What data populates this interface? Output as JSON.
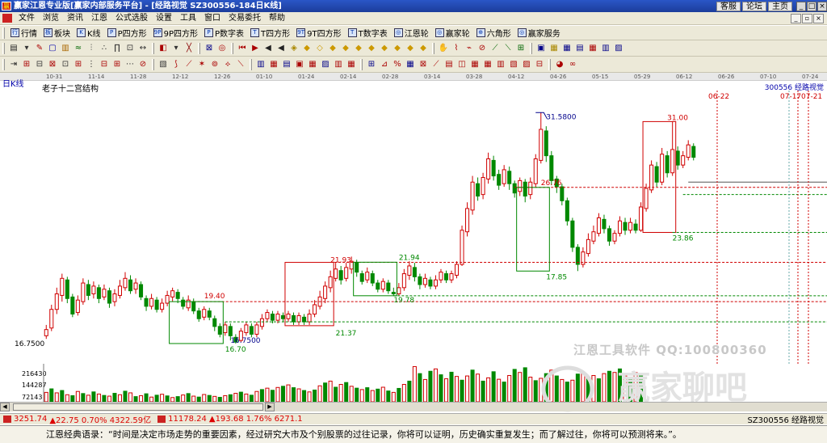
{
  "titlebar": {
    "title": "赢家江恩专业版[赢家内部服务平台] - [经路视觉  SZ300556-184日K线]",
    "links": [
      "客服",
      "论坛",
      "主页"
    ]
  },
  "menu": [
    "文件",
    "浏览",
    "资讯",
    "江恩",
    "公式选股",
    "设置",
    "工具",
    "窗口",
    "交易委托",
    "帮助"
  ],
  "toolbar1": [
    {
      "icon": "行",
      "label": "行情"
    },
    {
      "icon": "板",
      "label": "板块"
    },
    {
      "icon": "K",
      "label": "K线"
    },
    {
      "icon": "P",
      "label": "P四方形"
    },
    {
      "icon": "9P",
      "label": "9P四方形"
    },
    {
      "icon": "P",
      "label": "P数字表"
    },
    {
      "icon": "T",
      "label": "T四方形"
    },
    {
      "icon": "9T",
      "label": "9T四方形"
    },
    {
      "icon": "T",
      "label": "T数字表"
    },
    {
      "icon": "◎",
      "label": "江恩轮"
    },
    {
      "icon": "◎",
      "label": "赢家轮"
    },
    {
      "icon": "⊕",
      "label": "六角形"
    },
    {
      "icon": "◎",
      "label": "赢家服务"
    }
  ],
  "chart": {
    "period_label": "日K线",
    "title": "老子十二宫结构",
    "stock_label": "300556  经路视觉",
    "watermark": "江恩工具软件  QQ:100800360",
    "date_ticks": [
      "10-31",
      "11-14",
      "11-28",
      "12-12",
      "12-26",
      "01-10",
      "01-24",
      "02-14",
      "02-28",
      "03-14",
      "03-28",
      "04-12",
      "04-26",
      "05-15",
      "05-29",
      "06-12",
      "06-26",
      "07-10",
      "07-24"
    ],
    "left_price_label": "16.7500",
    "volume_ticks": [
      "216430",
      "144287",
      "72143"
    ],
    "top_date_labels": [
      "06-22",
      "07-17",
      "07-21"
    ]
  },
  "chart_data": {
    "type": "candlestick",
    "title": "老子十二宫结构",
    "price_annotations": [
      "31.5800",
      "31.00",
      "26.76",
      "23.86",
      "21.94",
      "21.93",
      "21.37",
      "19.40",
      "19.78",
      "17.85",
      "16.70",
      "16.7500"
    ],
    "candles": [
      [
        17.2,
        17.6,
        17.9,
        17.0
      ],
      [
        17.7,
        18.9,
        19.2,
        17.5
      ],
      [
        18.9,
        19.9,
        20.3,
        18.6
      ],
      [
        19.8,
        20.9,
        21.2,
        19.4
      ],
      [
        20.8,
        19.6,
        21.0,
        19.3
      ],
      [
        19.7,
        18.6,
        19.9,
        18.4
      ],
      [
        18.7,
        19.5,
        19.8,
        18.5
      ],
      [
        19.4,
        20.6,
        20.9,
        19.2
      ],
      [
        20.5,
        19.8,
        20.8,
        19.5
      ],
      [
        19.9,
        20.4,
        20.7,
        19.6
      ],
      [
        20.3,
        19.6,
        20.5,
        19.3
      ],
      [
        19.7,
        20.2,
        20.5,
        19.5
      ],
      [
        20.1,
        19.3,
        20.3,
        19.0
      ],
      [
        19.4,
        19.9,
        20.2,
        19.1
      ],
      [
        19.8,
        20.4,
        20.8,
        19.6
      ],
      [
        20.3,
        20.9,
        21.3,
        20.1
      ],
      [
        20.8,
        20.1,
        21.1,
        19.9
      ],
      [
        20.2,
        20.6,
        20.9,
        19.9
      ],
      [
        20.5,
        19.7,
        20.7,
        19.5
      ],
      [
        19.6,
        19.1,
        19.8,
        18.8
      ],
      [
        19.1,
        19.6,
        19.9,
        18.9
      ],
      [
        19.5,
        18.9,
        19.7,
        18.7
      ],
      [
        18.9,
        19.3,
        19.6,
        18.7
      ],
      [
        19.3,
        19.8,
        20.1,
        19.1
      ],
      [
        19.7,
        20.1,
        20.3,
        19.4
      ],
      [
        20.0,
        19.6,
        20.2,
        19.3
      ],
      [
        19.5,
        19.1,
        19.7,
        18.9
      ],
      [
        19.0,
        19.5,
        19.8,
        18.8
      ],
      [
        19.4,
        18.8,
        19.6,
        18.6
      ],
      [
        18.8,
        18.3,
        19.0,
        18.1
      ],
      [
        18.4,
        18.9,
        19.1,
        18.2
      ],
      [
        18.8,
        18.4,
        19.0,
        18.2
      ],
      [
        18.3,
        17.8,
        18.5,
        17.5
      ],
      [
        17.8,
        17.3,
        18.0,
        17.1
      ],
      [
        17.4,
        17.9,
        18.1,
        17.2
      ],
      [
        17.8,
        17.2,
        18.0,
        16.9
      ],
      [
        17.1,
        16.8,
        17.3,
        16.7
      ],
      [
        16.9,
        17.5,
        17.7,
        16.8
      ],
      [
        17.4,
        17.9,
        18.1,
        17.2
      ],
      [
        17.8,
        17.3,
        18.0,
        17.1
      ],
      [
        17.3,
        17.9,
        18.1,
        17.1
      ],
      [
        17.8,
        18.3,
        18.6,
        17.6
      ],
      [
        18.3,
        18.7,
        18.9,
        18.1
      ],
      [
        18.6,
        18.2,
        18.8,
        18.0
      ],
      [
        18.2,
        18.6,
        18.8,
        18.0
      ],
      [
        18.5,
        18.3,
        18.7,
        18.1
      ],
      [
        18.3,
        18.6,
        18.8,
        18.1
      ],
      [
        18.5,
        18.1,
        18.7,
        17.9
      ],
      [
        18.1,
        18.5,
        18.7,
        17.9
      ],
      [
        18.4,
        18.1,
        18.6,
        17.9
      ],
      [
        18.1,
        18.6,
        18.9,
        17.9
      ],
      [
        18.6,
        19.2,
        19.5,
        18.4
      ],
      [
        19.1,
        19.7,
        20.1,
        18.9
      ],
      [
        19.6,
        20.4,
        20.7,
        19.3
      ],
      [
        20.3,
        21.0,
        21.4,
        20.0
      ],
      [
        20.9,
        21.5,
        21.9,
        20.7
      ],
      [
        21.4,
        20.8,
        21.7,
        20.5
      ],
      [
        20.9,
        21.6,
        21.9,
        20.7
      ],
      [
        21.5,
        22.0,
        22.3,
        21.2
      ],
      [
        21.9,
        21.3,
        22.1,
        21.0
      ],
      [
        21.2,
        20.7,
        21.4,
        20.5
      ],
      [
        20.8,
        21.3,
        21.6,
        20.6
      ],
      [
        21.2,
        20.6,
        21.4,
        20.4
      ],
      [
        20.6,
        20.2,
        20.8,
        20.0
      ],
      [
        20.2,
        20.7,
        20.9,
        20.0
      ],
      [
        20.6,
        20.1,
        20.8,
        19.9
      ],
      [
        20.0,
        19.9,
        20.3,
        19.8
      ],
      [
        19.9,
        20.3,
        20.6,
        19.8
      ],
      [
        20.3,
        21.2,
        21.5,
        20.1
      ],
      [
        21.1,
        21.7,
        22.0,
        20.8
      ],
      [
        21.6,
        21.0,
        21.9,
        20.7
      ],
      [
        21.0,
        20.5,
        21.2,
        20.2
      ],
      [
        20.5,
        20.9,
        21.2,
        20.3
      ],
      [
        20.8,
        20.4,
        21.0,
        20.2
      ],
      [
        20.4,
        20.8,
        21.1,
        20.2
      ],
      [
        20.8,
        21.3,
        21.5,
        20.6
      ],
      [
        21.2,
        20.8,
        21.4,
        20.6
      ],
      [
        20.8,
        21.2,
        21.4,
        20.6
      ],
      [
        21.1,
        21.8,
        22.0,
        20.9
      ],
      [
        21.8,
        24.0,
        24.3,
        21.7
      ],
      [
        23.9,
        25.4,
        25.8,
        23.6
      ],
      [
        25.3,
        27.1,
        27.5,
        25.0
      ],
      [
        27.0,
        26.2,
        27.4,
        25.9
      ],
      [
        26.3,
        27.4,
        27.7,
        26.0
      ],
      [
        27.3,
        28.6,
        29.0,
        27.0
      ],
      [
        28.5,
        27.5,
        28.8,
        27.2
      ],
      [
        27.6,
        26.9,
        27.9,
        26.6
      ],
      [
        27.0,
        27.9,
        28.2,
        26.8
      ],
      [
        27.8,
        27.0,
        28.1,
        26.6
      ],
      [
        27.0,
        26.4,
        27.2,
        26.1
      ],
      [
        26.5,
        27.2,
        27.4,
        26.2
      ],
      [
        27.1,
        26.2,
        27.3,
        25.8
      ],
      [
        26.3,
        27.1,
        27.4,
        26.0
      ],
      [
        27.0,
        28.6,
        28.9,
        26.8
      ],
      [
        28.5,
        30.5,
        31.58,
        28.3
      ],
      [
        30.4,
        28.8,
        30.7,
        28.4
      ],
      [
        28.8,
        27.2,
        29.1,
        26.9
      ],
      [
        27.3,
        26.8,
        27.5,
        26.4
      ],
      [
        26.8,
        25.9,
        27.0,
        25.6
      ],
      [
        25.9,
        24.6,
        26.1,
        24.3
      ],
      [
        24.6,
        22.9,
        24.8,
        22.6
      ],
      [
        22.9,
        21.8,
        23.1,
        21.37
      ],
      [
        21.8,
        22.6,
        22.9,
        21.6
      ],
      [
        22.5,
        23.4,
        23.8,
        22.3
      ],
      [
        23.3,
        23.9,
        24.3,
        23.1
      ],
      [
        23.8,
        24.8,
        25.1,
        23.6
      ],
      [
        24.7,
        24.1,
        25.0,
        23.8
      ],
      [
        24.1,
        23.3,
        24.3,
        23.0
      ],
      [
        23.3,
        23.8,
        24.0,
        23.1
      ],
      [
        23.8,
        24.6,
        24.9,
        23.6
      ],
      [
        24.5,
        24.0,
        24.8,
        23.7
      ],
      [
        24.0,
        24.5,
        24.8,
        23.8
      ],
      [
        24.4,
        24.0,
        24.7,
        23.8
      ],
      [
        24.0,
        25.5,
        25.8,
        23.9
      ],
      [
        25.4,
        26.7,
        27.0,
        25.2
      ],
      [
        26.6,
        28.2,
        28.5,
        26.4
      ],
      [
        28.1,
        27.1,
        28.4,
        26.8
      ],
      [
        27.1,
        28.9,
        29.3,
        26.9
      ],
      [
        28.8,
        27.7,
        29.1,
        27.4
      ],
      [
        27.7,
        29.2,
        31.0,
        27.5
      ],
      [
        29.1,
        28.2,
        29.4,
        27.9
      ],
      [
        28.2,
        28.8,
        29.1,
        28.0
      ],
      [
        28.7,
        29.5,
        29.8,
        28.5
      ],
      [
        29.4,
        28.7,
        29.6,
        28.5
      ]
    ],
    "volume": [
      [
        40,
        1
      ],
      [
        55,
        0
      ],
      [
        38,
        1
      ],
      [
        48,
        0
      ],
      [
        30,
        1
      ],
      [
        26,
        0
      ],
      [
        44,
        1
      ],
      [
        35,
        0
      ],
      [
        28,
        1
      ],
      [
        42,
        0
      ],
      [
        33,
        1
      ],
      [
        27,
        0
      ],
      [
        24,
        1
      ],
      [
        36,
        0
      ],
      [
        30,
        1
      ],
      [
        45,
        0
      ],
      [
        38,
        1
      ],
      [
        22,
        0
      ],
      [
        26,
        1
      ],
      [
        34,
        0
      ],
      [
        20,
        1
      ],
      [
        28,
        0
      ],
      [
        32,
        1
      ],
      [
        25,
        0
      ],
      [
        18,
        1
      ],
      [
        22,
        0
      ],
      [
        29,
        1
      ],
      [
        35,
        0
      ],
      [
        24,
        1
      ],
      [
        20,
        0
      ],
      [
        31,
        1
      ],
      [
        27,
        0
      ],
      [
        23,
        1
      ],
      [
        19,
        0
      ],
      [
        26,
        1
      ],
      [
        30,
        0
      ],
      [
        36,
        1
      ],
      [
        41,
        0
      ],
      [
        33,
        1
      ],
      [
        28,
        0
      ],
      [
        44,
        1
      ],
      [
        52,
        0
      ],
      [
        58,
        1
      ],
      [
        49,
        0
      ],
      [
        61,
        1
      ],
      [
        66,
        0
      ],
      [
        72,
        1
      ],
      [
        60,
        0
      ],
      [
        55,
        1
      ],
      [
        48,
        0
      ],
      [
        42,
        1
      ],
      [
        50,
        0
      ],
      [
        68,
        1
      ],
      [
        80,
        0
      ],
      [
        88,
        1
      ],
      [
        62,
        0
      ],
      [
        74,
        1
      ],
      [
        82,
        0
      ],
      [
        66,
        1
      ],
      [
        58,
        0
      ],
      [
        52,
        1
      ],
      [
        60,
        0
      ],
      [
        48,
        1
      ],
      [
        54,
        0
      ],
      [
        62,
        1
      ],
      [
        46,
        0
      ],
      [
        40,
        1
      ],
      [
        57,
        0
      ],
      [
        74,
        1
      ],
      [
        88,
        0
      ],
      [
        150,
        1
      ],
      [
        120,
        0
      ],
      [
        95,
        1
      ],
      [
        130,
        0
      ],
      [
        140,
        1
      ],
      [
        115,
        0
      ],
      [
        98,
        1
      ],
      [
        126,
        0
      ],
      [
        108,
        1
      ],
      [
        92,
        0
      ],
      [
        110,
        1
      ],
      [
        135,
        0
      ],
      [
        118,
        1
      ],
      [
        88,
        0
      ],
      [
        102,
        1
      ],
      [
        128,
        0
      ],
      [
        96,
        1
      ],
      [
        84,
        0
      ],
      [
        112,
        1
      ],
      [
        138,
        0
      ],
      [
        125,
        1
      ],
      [
        145,
        0
      ],
      [
        105,
        1
      ],
      [
        90,
        0
      ],
      [
        100,
        1
      ],
      [
        120,
        0
      ],
      [
        135,
        1
      ],
      [
        110,
        0
      ],
      [
        95,
        1
      ],
      [
        84,
        0
      ],
      [
        92,
        1
      ],
      [
        118,
        0
      ],
      [
        126,
        1
      ],
      [
        105,
        0
      ],
      [
        112,
        1
      ],
      [
        98,
        0
      ],
      [
        120,
        1
      ],
      [
        130,
        0
      ],
      [
        125,
        1
      ],
      [
        140,
        0
      ],
      [
        110,
        1
      ],
      [
        98,
        0
      ],
      [
        124,
        1
      ],
      [
        116,
        0
      ]
    ],
    "xlabel": "",
    "ylabel": "",
    "ylim": [
      15.5,
      33.0
    ]
  },
  "status": {
    "idx1_val": "3251.74",
    "idx1_chg": "▲22.75 0.70% 4322.59亿",
    "idx2_val": "11178.24",
    "idx2_chg": "▲193.68 1.76% 6271.1",
    "right": "SZ300556 经路视觉"
  },
  "quote": "江恩经典语录：“时间是决定市场走势的重要因素，经过研究大市及个别股票的过往记录，你将可以证明，历史确实重复发生；而了解过往，你将可以预测将来。”。"
}
